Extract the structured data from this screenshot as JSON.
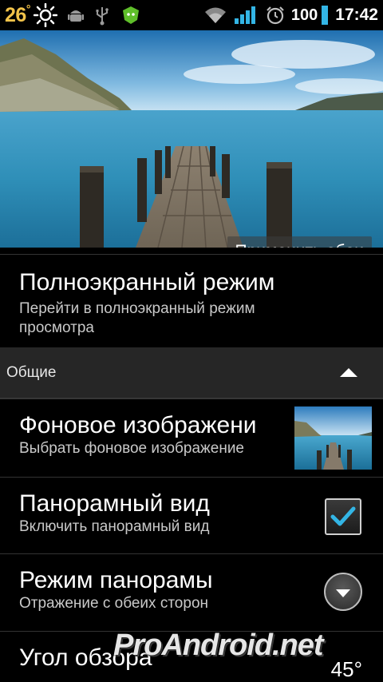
{
  "status_bar": {
    "temperature": "26",
    "temperature_unit": "°",
    "battery": "100",
    "time": "17:42",
    "icons": [
      "sun-icon",
      "android-debug-icon",
      "usb-icon",
      "antivirus-icon",
      "wifi-icon",
      "signal-icon",
      "alarm-icon",
      "battery-icon"
    ]
  },
  "preview": {
    "apply_button": "Применить обои"
  },
  "settings": {
    "fullscreen": {
      "title": "Полноэкранный режим",
      "subtitle": "Перейти в полноэкранный режим просмотра"
    },
    "category": {
      "label": "Общие"
    },
    "background_image": {
      "title": "Фоновое изображени",
      "subtitle": "Выбрать фоновое изображение"
    },
    "panorama_view": {
      "title": "Панорамный вид",
      "subtitle": "Включить панорамный вид",
      "checked": true
    },
    "panorama_mode": {
      "title": "Режим панорамы",
      "subtitle": "Отражение с обеих сторон"
    },
    "view_angle": {
      "title": "Угол обзора",
      "value": "45°"
    }
  },
  "watermark": "ProAndroid.net",
  "colors": {
    "temperature": "#f2c34a",
    "checkmark": "#33b5e5",
    "category_bg": "#262626"
  }
}
